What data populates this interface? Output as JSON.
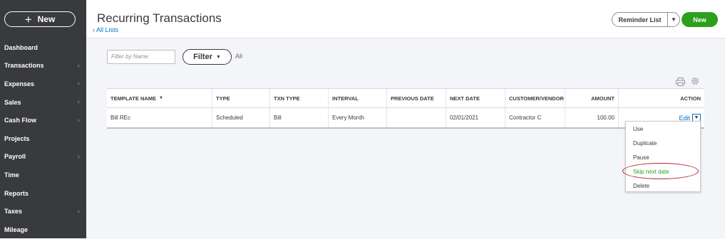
{
  "sidebar": {
    "new_label": "New",
    "items": [
      {
        "label": "Dashboard",
        "chevron": false
      },
      {
        "label": "Transactions",
        "chevron": true
      },
      {
        "label": "Expenses",
        "chevron": true
      },
      {
        "label": "Sales",
        "chevron": true
      },
      {
        "label": "Cash Flow",
        "chevron": true
      },
      {
        "label": "Projects",
        "chevron": false
      },
      {
        "label": "Payroll",
        "chevron": true
      },
      {
        "label": "Time",
        "chevron": false
      },
      {
        "label": "Reports",
        "chevron": false
      },
      {
        "label": "Taxes",
        "chevron": true
      },
      {
        "label": "Mileage",
        "chevron": false
      }
    ]
  },
  "header": {
    "title": "Recurring Transactions",
    "back_link": "All Lists",
    "reminder_label": "Reminder List",
    "new_label": "New"
  },
  "filter": {
    "placeholder": "Filter by Name",
    "button_label": "Filter",
    "value": "All"
  },
  "table": {
    "columns": [
      "TEMPLATE NAME",
      "TYPE",
      "TXN TYPE",
      "INTERVAL",
      "PREVIOUS DATE",
      "NEXT DATE",
      "CUSTOMER/VENDOR",
      "AMOUNT",
      "ACTION"
    ],
    "rows": [
      {
        "template_name": "Bill REc",
        "type": "Scheduled",
        "txn_type": "Bill",
        "interval": "Every Month",
        "previous_date": "",
        "next_date": "02/01/2021",
        "customer_vendor": "Contractor C",
        "amount": "100.00",
        "action": "Edit"
      }
    ]
  },
  "action_menu": {
    "items": [
      "Use",
      "Duplicate",
      "Pause",
      "Skip next date",
      "Delete"
    ]
  },
  "colors": {
    "sidebar_bg": "#393a3d",
    "accent_green": "#2ca01c",
    "link_blue": "#0077c5",
    "highlight_oval": "#b8202b"
  }
}
